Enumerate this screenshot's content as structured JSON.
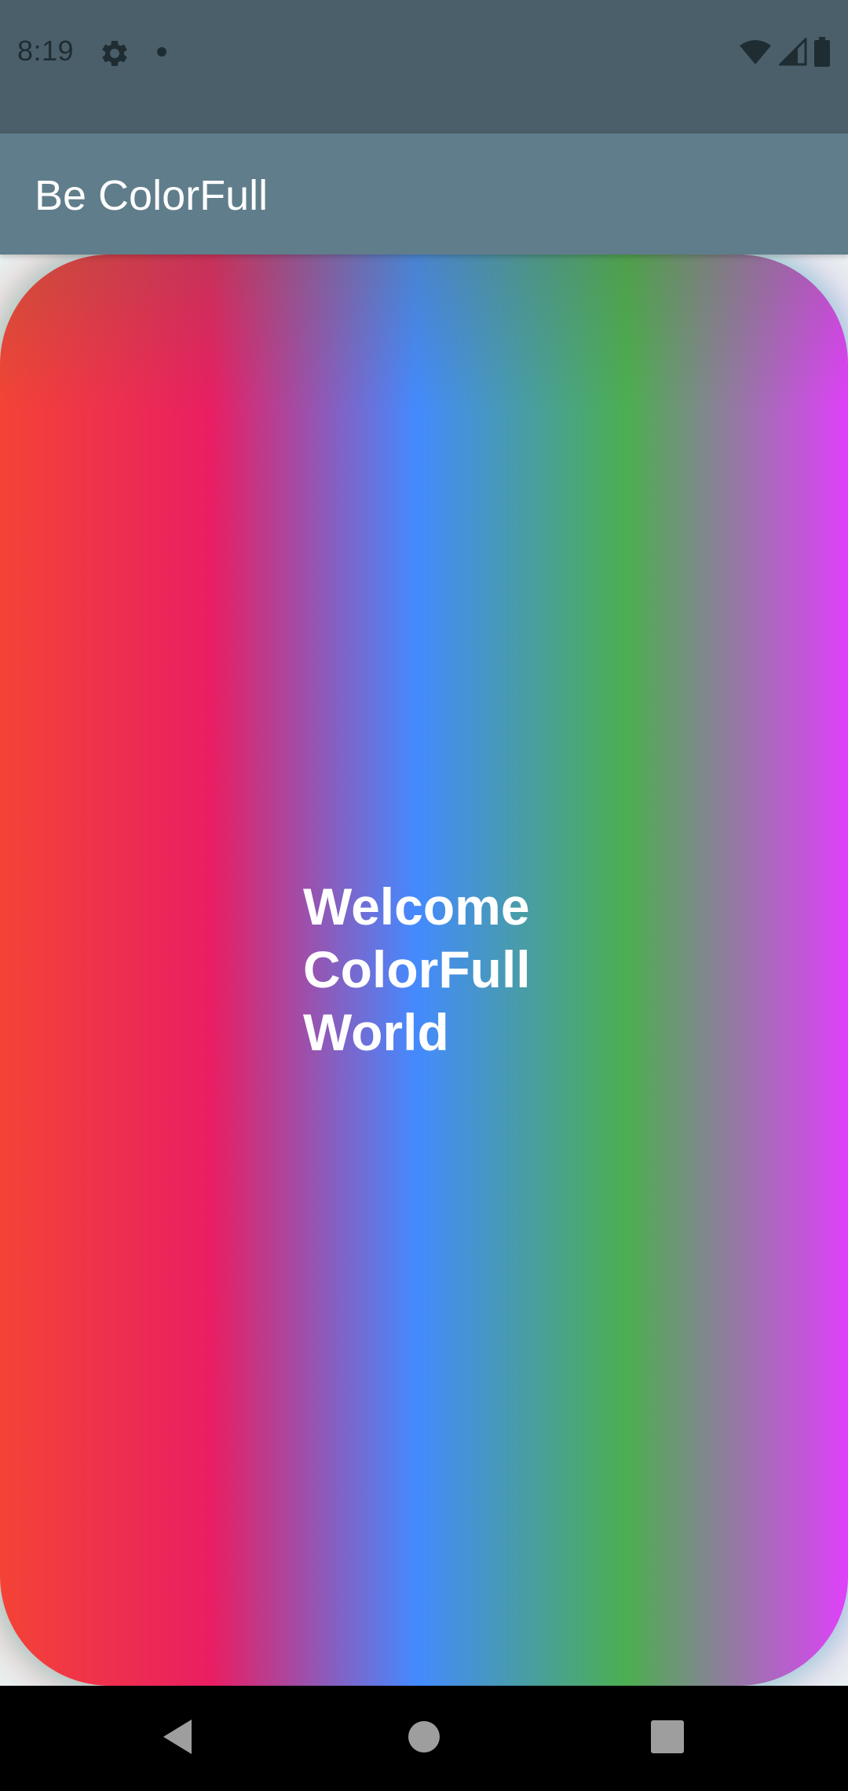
{
  "status_bar": {
    "time": "8:19",
    "icons": [
      "settings-icon",
      "notification-dot-icon",
      "wifi-icon",
      "signal-icon",
      "battery-icon"
    ]
  },
  "app_bar": {
    "title": "Be ColorFull",
    "color": "#607d8b"
  },
  "main": {
    "welcome_lines": [
      "Welcome",
      "ColorFull",
      "World"
    ],
    "gradient_colors": [
      "#f44336",
      "#e91e63",
      "#448aff",
      "#4caf50",
      "#e040fb"
    ]
  },
  "nav_bar": {
    "buttons": [
      "back-icon",
      "home-icon",
      "recents-icon"
    ]
  }
}
